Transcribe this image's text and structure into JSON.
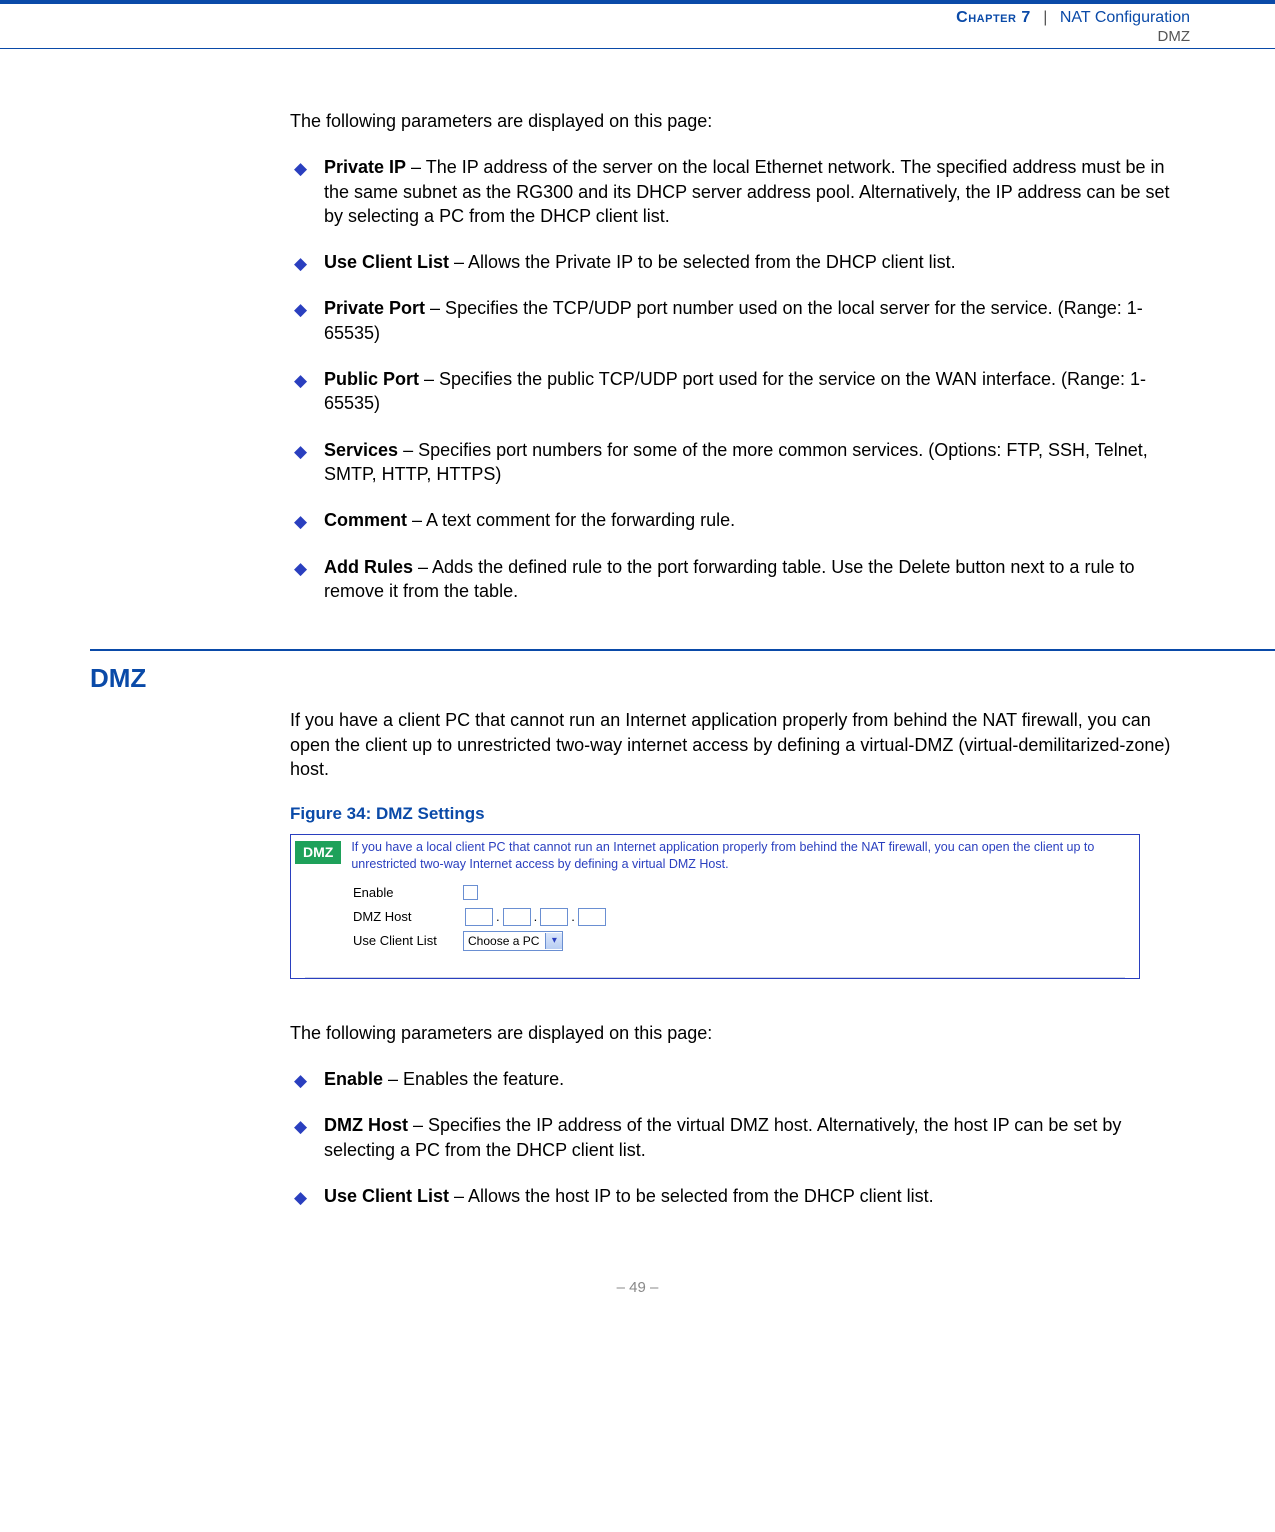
{
  "header": {
    "chapter_label": "Chapter 7",
    "chapter_title": "NAT Configuration",
    "sub": "DMZ"
  },
  "intro1": "The following parameters are displayed on this page:",
  "params1": [
    {
      "term": "Private IP",
      "desc": " – The IP address of the server on the local Ethernet network. The specified address must be in the same subnet as the RG300 and its DHCP server address pool. Alternatively, the IP address can be set by selecting a PC from the DHCP client list."
    },
    {
      "term": "Use Client List",
      "desc": " – Allows the Private IP to be selected from the DHCP client list."
    },
    {
      "term": "Private Port",
      "desc": " – Specifies the TCP/UDP port number used on the local server for the service. (Range: 1-65535)"
    },
    {
      "term": "Public Port",
      "desc": " – Specifies the public TCP/UDP port used for the service on the WAN interface. (Range: 1-65535)"
    },
    {
      "term": "Services",
      "desc": " – Specifies port numbers for some of the more common services. (Options: FTP, SSH, Telnet, SMTP, HTTP, HTTPS)"
    },
    {
      "term": "Comment",
      "desc": " – A text comment for the forwarding rule."
    },
    {
      "term": "Add Rules",
      "desc": " – Adds the defined rule to the port forwarding table. Use the Delete button next to a rule to remove it from the table."
    }
  ],
  "section": {
    "title": "DMZ",
    "para": "If you have a client PC that cannot run an Internet application properly from behind the NAT firewall, you can open the client up to unrestricted two-way internet access by defining a virtual-DMZ (virtual-demilitarized-zone) host."
  },
  "figure": {
    "caption": "Figure 34:  DMZ Settings",
    "badge": "DMZ",
    "desc": "If you have a local client PC that cannot run an Internet application properly from behind the NAT firewall, you can open the client up to unrestricted two-way Internet access by defining a virtual DMZ Host.",
    "fields": {
      "enable": "Enable",
      "dmz_host": "DMZ Host",
      "use_client": "Use Client List",
      "select_value": "Choose a PC"
    }
  },
  "intro2": "The following parameters are displayed on this page:",
  "params2": [
    {
      "term": "Enable",
      "desc": " – Enables the feature."
    },
    {
      "term": "DMZ Host",
      "desc": " – Specifies the IP address of the virtual DMZ host. Alternatively, the host IP can be set by selecting a PC from the DHCP client list."
    },
    {
      "term": "Use Client List",
      "desc": " – Allows the host IP to be selected from the DHCP client list."
    }
  ],
  "pagenum": "–  49  –"
}
